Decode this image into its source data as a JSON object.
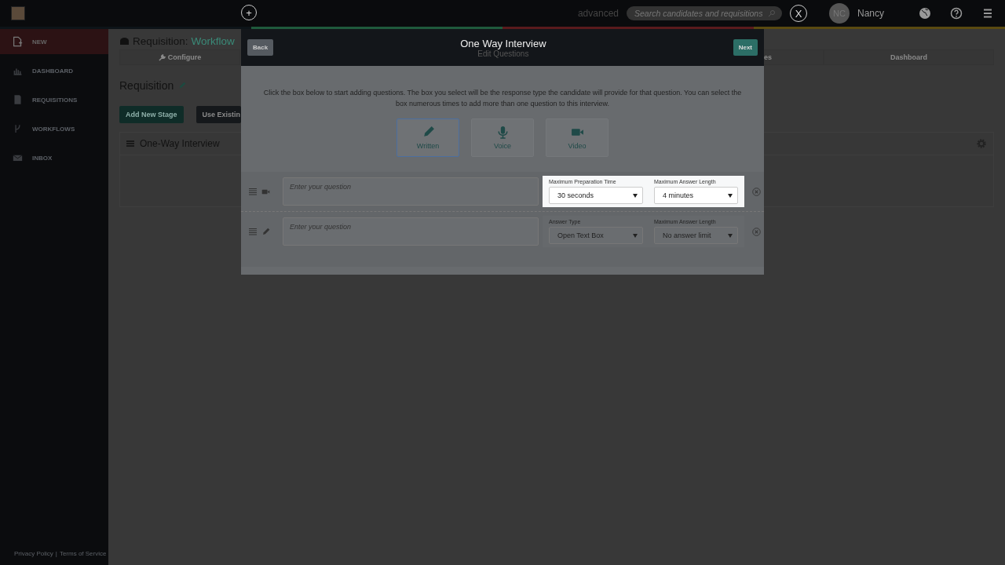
{
  "topbar": {
    "add_button": "+",
    "advanced_link": "advanced",
    "search": {
      "placeholder": "Search candidates and requisitions"
    },
    "close_tour": "X",
    "user": {
      "initials": "NC",
      "name": "Nancy"
    }
  },
  "sidebar": {
    "items": [
      {
        "label": "NEW",
        "kind": "new",
        "selected": true
      },
      {
        "label": "DASHBOARD",
        "kind": "dashboard",
        "selected": false
      },
      {
        "label": "REQUISITIONS",
        "kind": "requisitions",
        "selected": false
      },
      {
        "label": "WORKFLOWS",
        "kind": "workflows",
        "selected": false
      },
      {
        "label": "INBOX",
        "kind": "inbox",
        "selected": false
      }
    ],
    "footer_links": [
      "Privacy Policy",
      "Terms of Service"
    ],
    "footer_separator": "|"
  },
  "page": {
    "title": "Requisition:",
    "title_link": "Workflow",
    "steps": [
      "Configure",
      "es",
      "Dashboard"
    ],
    "heading": "Requisition",
    "buttons": [
      "Add New Stage",
      "Use Existin"
    ],
    "stage_card": {
      "title": "One-Way Interview"
    }
  },
  "modal": {
    "back": "Back",
    "title": "One Way Interview",
    "subtitle": "Edit Questions",
    "next": "Next",
    "instructions": "Click the box below to start adding questions. The box you select will be the response type the candidate will provide for that question. You can select the box numerous times to add more than one question to this interview.",
    "types": [
      {
        "label": "Written",
        "kind": "written",
        "selected": true
      },
      {
        "label": "Voice",
        "kind": "voice",
        "selected": false
      },
      {
        "label": "Video",
        "kind": "video",
        "selected": false
      }
    ],
    "questions": [
      {
        "kind": "video",
        "placeholder": "Enter your question",
        "spotlight": true,
        "fields": [
          {
            "label": "Maximum Preparation Time",
            "value": "30 seconds"
          },
          {
            "label": "Maximum Answer Length",
            "value": "4 minutes"
          }
        ]
      },
      {
        "kind": "written",
        "placeholder": "Enter your question",
        "spotlight": false,
        "fields": [
          {
            "label": "Answer Type",
            "value": "Open Text Box"
          },
          {
            "label": "Maximum Answer Length",
            "value": "No answer limit"
          }
        ]
      }
    ]
  }
}
